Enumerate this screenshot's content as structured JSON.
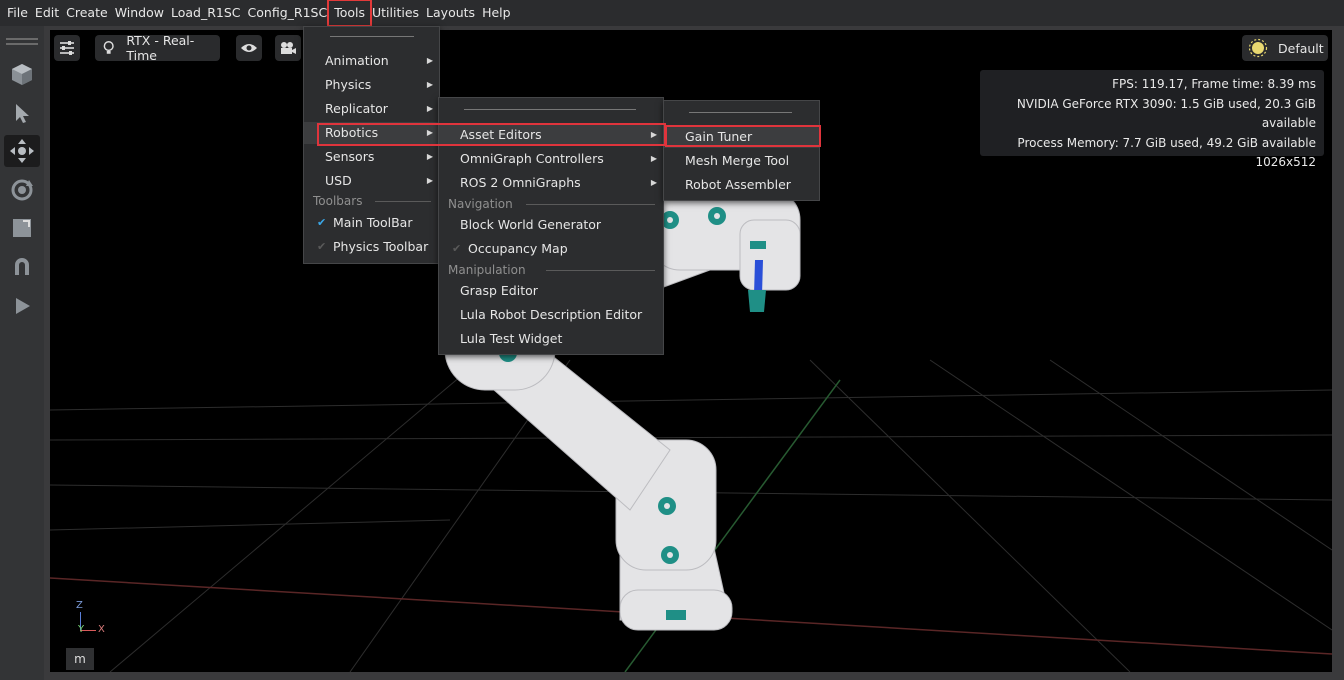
{
  "menubar": {
    "items": [
      "File",
      "Edit",
      "Create",
      "Window",
      "Load_R1SC",
      "Config_R1SC",
      "Tools",
      "Utilities",
      "Layouts",
      "Help"
    ],
    "active": "Tools"
  },
  "viewport_toolbar": {
    "renderer_label": "RTX - Real-Time",
    "lighting_label": "Default"
  },
  "stats": {
    "fps": "FPS: 119.17, Frame time: 8.39 ms",
    "gpu": "NVIDIA GeForce RTX 3090: 1.5 GiB used, 20.3 GiB available",
    "memory": "Process Memory: 7.7 GiB used, 49.2 GiB available",
    "resolution": "1026x512"
  },
  "axis": {
    "z": "Z",
    "y": "Y",
    "x": "X"
  },
  "units_button": "m",
  "tools_menu": {
    "items": [
      "Animation",
      "Physics",
      "Replicator",
      "Robotics",
      "Sensors",
      "USD"
    ],
    "toolbars_header": "Toolbars",
    "toolbars": [
      {
        "label": "Main ToolBar",
        "checked": true
      },
      {
        "label": "Physics Toolbar",
        "checked": false
      }
    ]
  },
  "robotics_menu": {
    "items": [
      "Asset Editors",
      "OmniGraph Controllers",
      "ROS 2 OmniGraphs"
    ],
    "navigation_header": "Navigation",
    "navigation": [
      "Block World Generator",
      "Occupancy Map"
    ],
    "manipulation_header": "Manipulation",
    "manipulation": [
      "Grasp Editor",
      "Lula Robot Description Editor",
      "Lula Test Widget"
    ]
  },
  "asset_editors_menu": {
    "items": [
      "Gain Tuner",
      "Mesh Merge Tool",
      "Robot Assembler"
    ]
  },
  "colors": {
    "highlight": "#e0343c",
    "check": "#3aa7e8"
  }
}
